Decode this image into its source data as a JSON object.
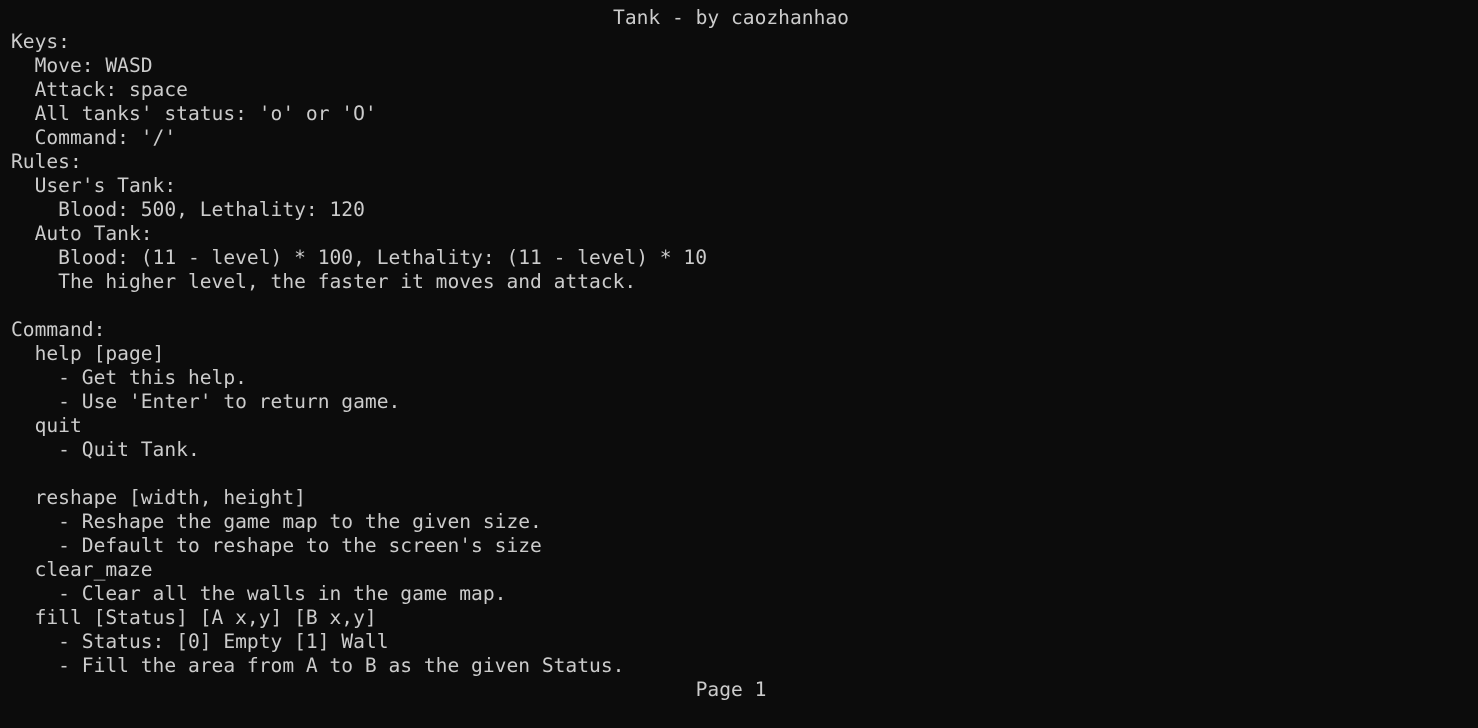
{
  "window": {
    "background": "#0c0c0c",
    "text_color": "#cccccc"
  },
  "title": "Tank - by caozhanhao",
  "lines": [
    "Keys:",
    "  Move: WASD",
    "  Attack: space",
    "  All tanks' status: 'o' or 'O'",
    "  Command: '/'",
    "Rules:",
    "  User's Tank:",
    "    Blood: 500, Lethality: 120",
    "  Auto Tank:",
    "    Blood: (11 - level) * 100, Lethality: (11 - level) * 10",
    "    The higher level, the faster it moves and attack.",
    "",
    "Command:",
    "  help [page]",
    "    - Get this help.",
    "    - Use 'Enter' to return game.",
    "  quit",
    "    - Quit Tank.",
    "",
    "  reshape [width, height]",
    "    - Reshape the game map to the given size.",
    "    - Default to reshape to the screen's size",
    "  clear_maze",
    "    - Clear all the walls in the game map.",
    "  fill [Status] [A x,y] [B x,y]",
    "    - Status: [0] Empty [1] Wall",
    "    - Fill the area from A to B as the given Status."
  ],
  "page_indicator": "Page 1"
}
